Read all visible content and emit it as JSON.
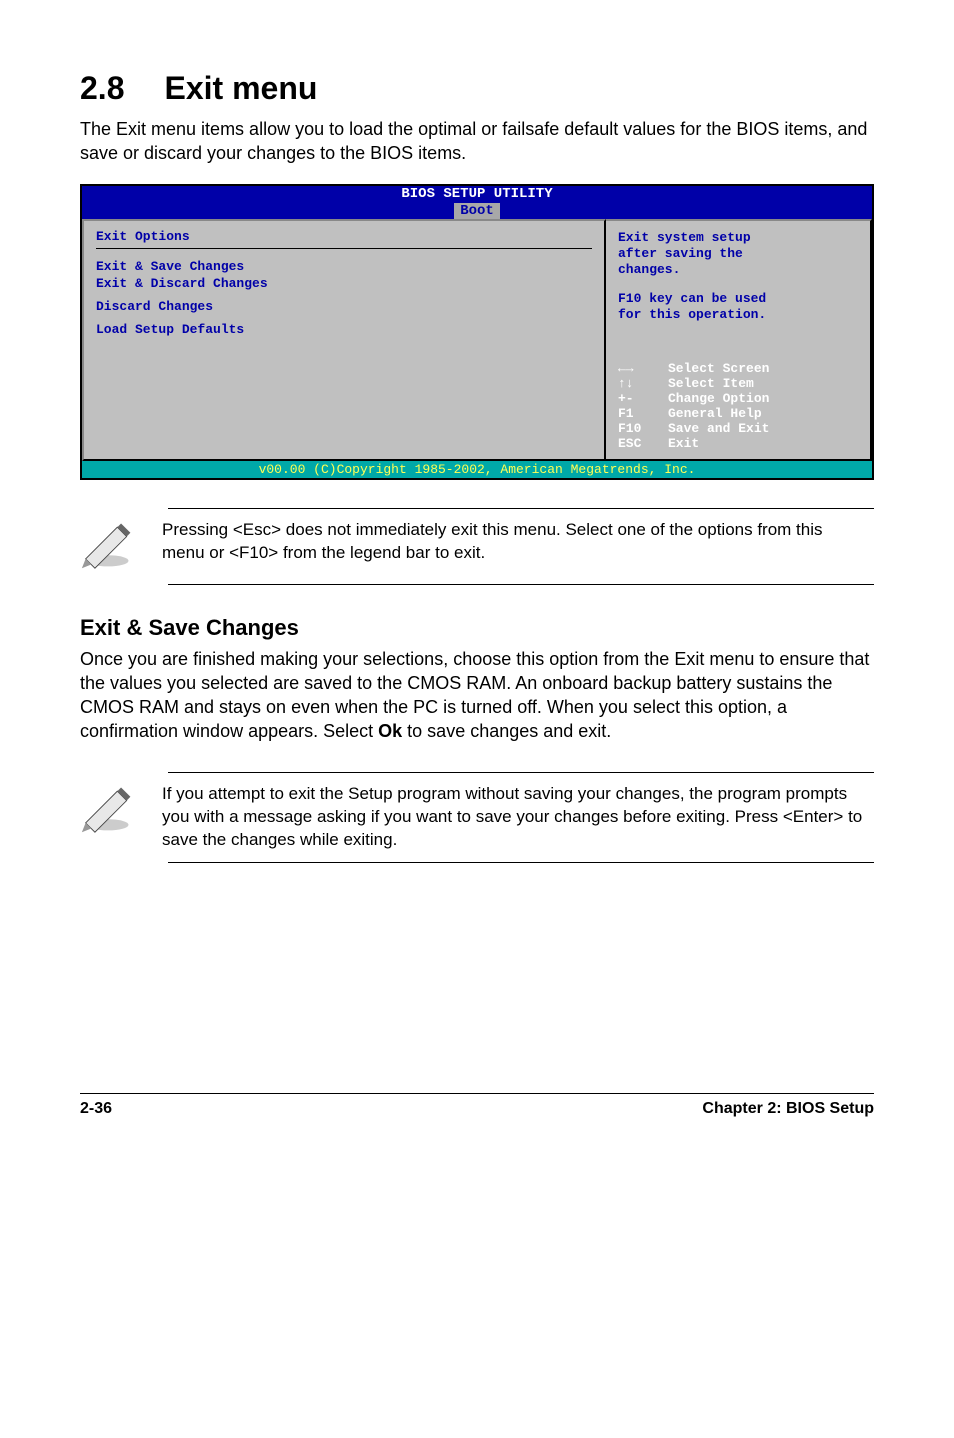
{
  "header": {
    "section_number": "2.8",
    "section_title": "Exit menu"
  },
  "intro_text": "The Exit menu items allow you to load the optimal or failsafe default values for the BIOS items, and save or discard your changes to the BIOS items.",
  "bios": {
    "title": "BIOS SETUP UTILITY",
    "active_tab": "Boot",
    "left": {
      "heading": "Exit Options",
      "items": [
        "Exit & Save Changes",
        "Exit & Discard Changes",
        "Discard Changes",
        "Load Setup Defaults"
      ]
    },
    "help": {
      "line1": "Exit system setup",
      "line2": "after saving the",
      "line3": "changes.",
      "line4": "F10 key can be used",
      "line5": "for this operation."
    },
    "legend": [
      {
        "key": "←→",
        "label": "Select Screen"
      },
      {
        "key": "↑↓",
        "label": "Select Item"
      },
      {
        "key": "+-",
        "label": "Change Option"
      },
      {
        "key": "F1",
        "label": "General Help"
      },
      {
        "key": "F10",
        "label": "Save and Exit"
      },
      {
        "key": "ESC",
        "label": "Exit"
      }
    ],
    "footer": "v00.00 (C)Copyright 1985-2002, American Megatrends, Inc."
  },
  "note1": "Pressing <Esc> does not immediately exit this menu. Select one of the options from this menu or <F10> from the legend bar to exit.",
  "section2_title": "Exit & Save Changes",
  "section2_body_pre": "Once you are finished making your selections, choose this option from the Exit menu to ensure that the values you selected are saved to the CMOS RAM. An onboard backup battery sustains the CMOS RAM and stays on even when the PC is turned off. When you select this option, a confirmation window appears. Select ",
  "section2_body_bold": "Ok",
  "section2_body_post": " to save changes and exit.",
  "note2_pre": " If you attempt to exit the Setup program without saving your changes, the program prompts you with a message asking if you want to save your changes before exiting. Press ",
  "note2_key": "<Enter>",
  "note2_post": "  to save the  changes while exiting.",
  "footer_left": "2-36",
  "footer_right": "Chapter 2: BIOS Setup"
}
